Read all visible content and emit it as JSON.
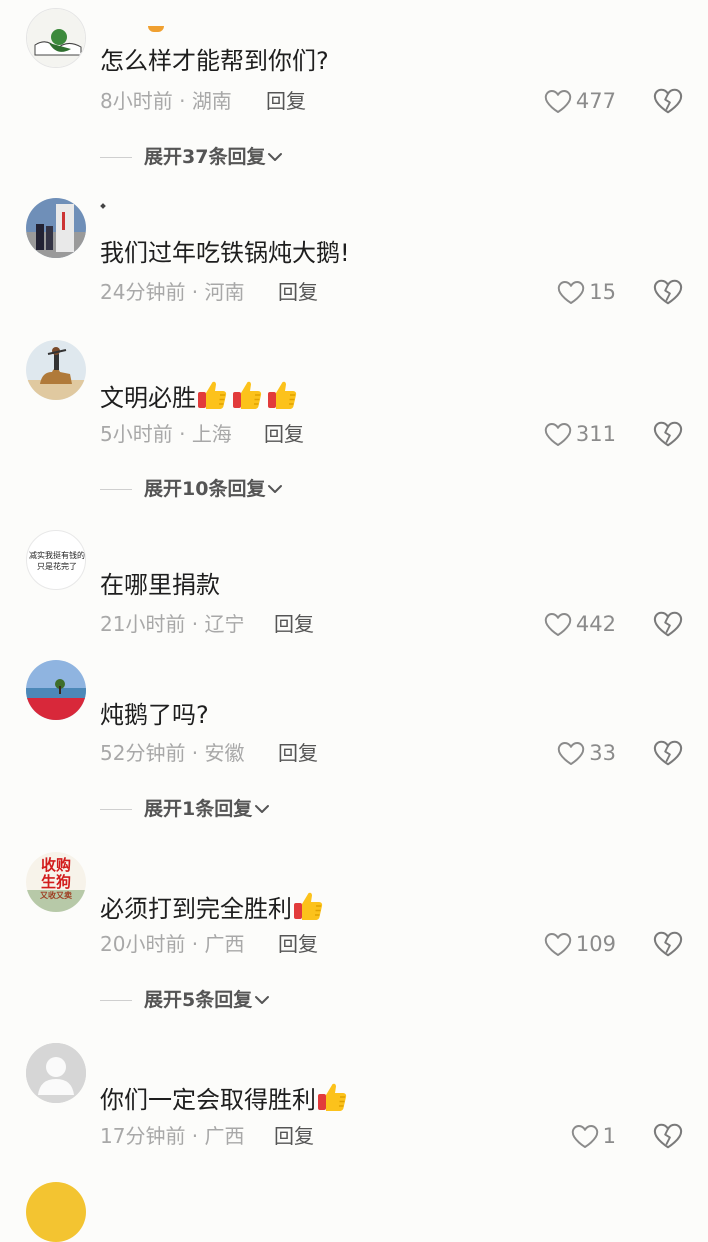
{
  "comments": [
    {
      "content": "怎么样才能帮到你们?",
      "time": "8小时前",
      "location": "湖南",
      "reply_label": "回复",
      "likes": "477",
      "expand": "展开37条回复"
    },
    {
      "content": "我们过年吃铁锅炖大鹅!",
      "time": "24分钟前",
      "location": "河南",
      "reply_label": "回复",
      "likes": "15"
    },
    {
      "content": "文明必胜",
      "time": "5小时前",
      "location": "上海",
      "reply_label": "回复",
      "likes": "311",
      "expand": "展开10条回复"
    },
    {
      "content": "在哪里捐款",
      "time": "21小时前",
      "location": "辽宁",
      "reply_label": "回复",
      "likes": "442",
      "avatar_text": [
        "减实我挺有钱的",
        "只是花完了"
      ]
    },
    {
      "content": "炖鹅了吗?",
      "time": "52分钟前",
      "location": "安徽",
      "reply_label": "回复",
      "likes": "33",
      "expand": "展开1条回复"
    },
    {
      "content": "必须打到完全胜利",
      "time": "20小时前",
      "location": "广西",
      "reply_label": "回复",
      "likes": "109",
      "expand": "展开5条回复",
      "avatar_text": [
        "收购",
        "生狗",
        "又收又卖"
      ]
    },
    {
      "content": "你们一定会取得胜利",
      "time": "17分钟前",
      "location": "广西",
      "reply_label": "回复",
      "likes": "1"
    }
  ],
  "meta_separator": " · ",
  "icons": {
    "like": "heart-outline-icon",
    "dislike": "broken-heart-icon",
    "expand": "chevron-down-icon",
    "emoji": "thumbs-up-emoji"
  },
  "colors": {
    "background": "#fcfcfa",
    "text": "#1e1e1e",
    "meta": "#a8a8a8",
    "icon": "#8b8b8b"
  }
}
